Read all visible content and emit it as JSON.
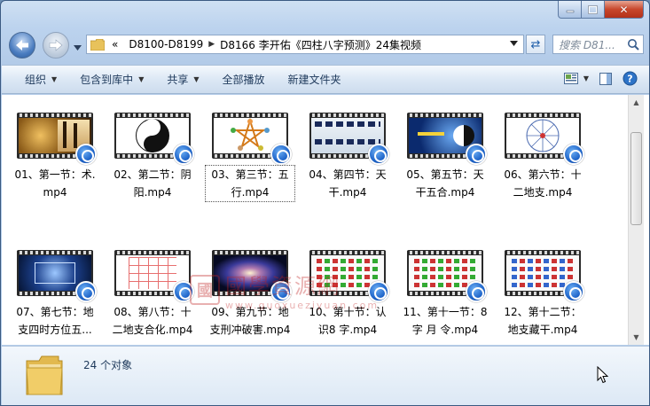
{
  "window": {
    "caption": {
      "minimize_glyph": "—",
      "close_glyph": "✕"
    }
  },
  "address": {
    "overflow": "«",
    "crumbs": [
      "D8100-D8199",
      "D8166 李开佑《四柱八字预测》24集视频"
    ],
    "search_placeholder": "搜索 D81..."
  },
  "toolbar": {
    "organize": "组织",
    "include_in_library": "包含到库中",
    "share": "共享",
    "play_all": "全部播放",
    "new_folder": "新建文件夹"
  },
  "files": [
    {
      "name": "01、第一节：术.mp4",
      "line1": "01、第一节：术.",
      "line2": "mp4",
      "thumb": "gold-calligraphy"
    },
    {
      "name": "02、第二节：阴阳.mp4",
      "line1": "02、第二节：阴",
      "line2": "阳.mp4",
      "thumb": "yin-yang"
    },
    {
      "name": "03、第三节：五行.mp4",
      "line1": "03、第三节：五",
      "line2": "行.mp4",
      "thumb": "five-elements-star",
      "selected": true
    },
    {
      "name": "04、第四节：天干.mp4",
      "line1": "04、第四节：天",
      "line2": "干.mp4",
      "thumb": "heavenly-stems-text"
    },
    {
      "name": "05、第五节：天干五合.mp4",
      "line1": "05、第五节：天",
      "line2": "干五合.mp4",
      "thumb": "bagua-blue"
    },
    {
      "name": "06、第六节：十二地支.mp4",
      "line1": "06、第六节：十",
      "line2": "二地支.mp4",
      "thumb": "zodiac-wheel"
    },
    {
      "name": "07、第七节：地支四时方位五...",
      "line1": "07、第七节：地",
      "line2": "支四时方位五...",
      "thumb": "galaxy-chart"
    },
    {
      "name": "08、第八节：十二地支合化.mp4",
      "line1": "08、第八节：十",
      "line2": "二地支合化.mp4",
      "thumb": "hand-grid"
    },
    {
      "name": "09、第九节：地支刑冲破害.mp4",
      "line1": "09、第九节：地",
      "line2": "支刑冲破害.mp4",
      "thumb": "galaxy"
    },
    {
      "name": "10、第十节：认识8 字.mp4",
      "line1": "10、第十节：认",
      "line2": "识8 字.mp4",
      "thumb": "table-chart"
    },
    {
      "name": "11、第十一节：8 字 月 令.mp4",
      "line1": "11、第十一节：8",
      "line2": "字 月 令.mp4",
      "thumb": "table-chart"
    },
    {
      "name": "12、第十二节：地支藏干.mp4",
      "line1": "12、第十二节：",
      "line2": "地支藏干.mp4",
      "thumb": "table-chart-2"
    }
  ],
  "watermark": {
    "seal": "國",
    "text": "國學資源網",
    "url": "www.guoxueziyuan.com"
  },
  "details": {
    "count": "24 个对象"
  },
  "colors": {
    "accent": "#1e395b",
    "window_chrome": "#bcd3ee",
    "close_red": "#c8472c"
  }
}
